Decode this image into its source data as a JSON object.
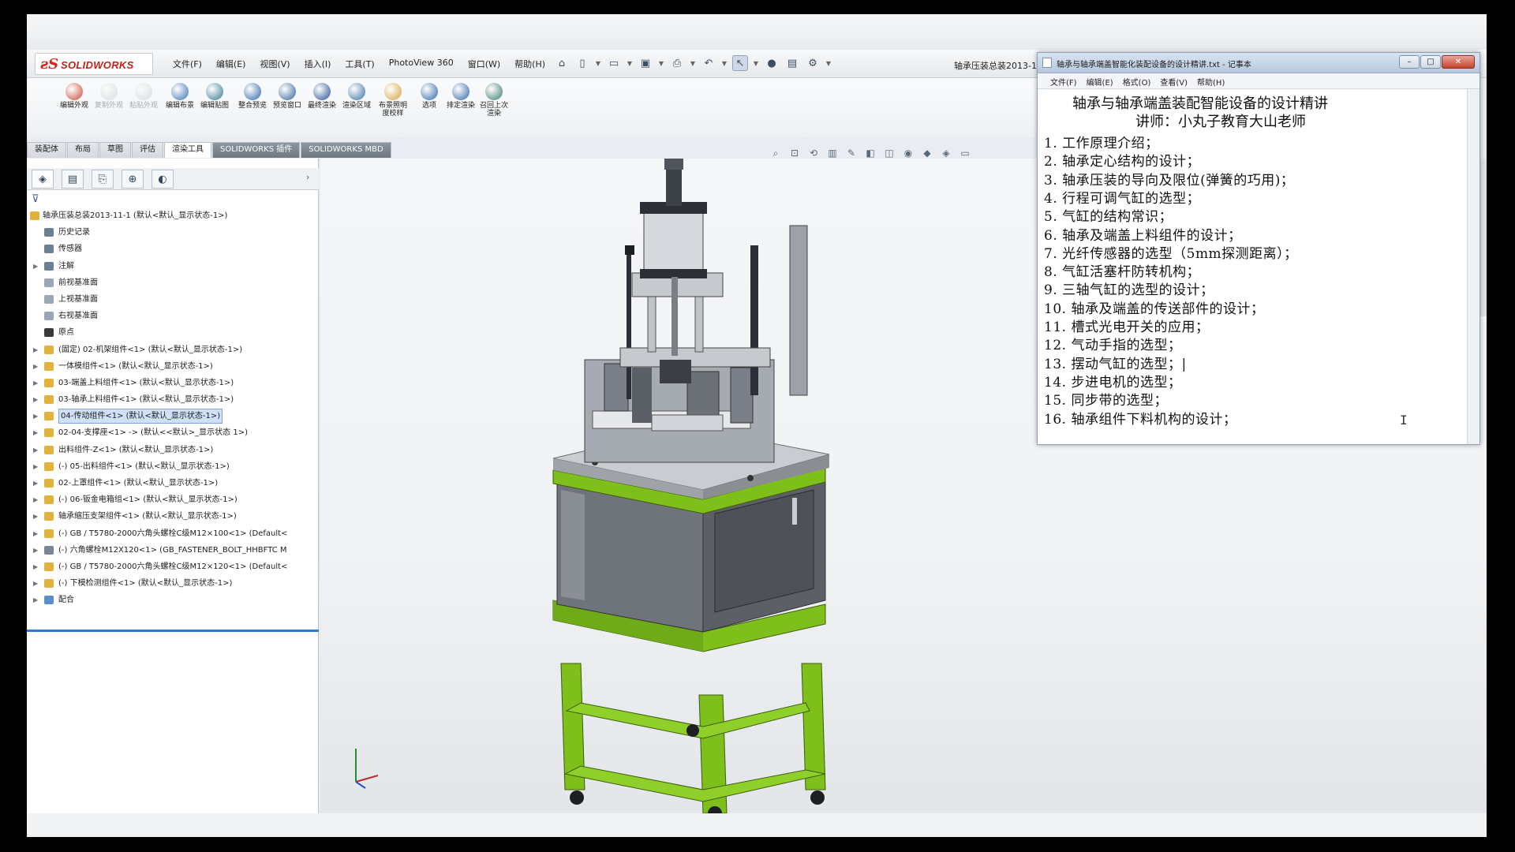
{
  "app": {
    "logo_ds": "ƨS",
    "logo_name": "SOLIDWORKS",
    "menus": [
      "文件(F)",
      "编辑(E)",
      "视图(V)",
      "插入(I)",
      "工具(T)",
      "PhotoView 360",
      "窗口(W)",
      "帮助(H)"
    ],
    "document_title": "轴承压装总装2013-1",
    "toolbar_icons": [
      "home-icon",
      "new-doc-icon",
      "open-icon",
      "save-icon",
      "print-icon",
      "undo-icon",
      "select-icon",
      "rebuild-icon",
      "file-props-icon",
      "options-icon"
    ]
  },
  "command_manager": {
    "commands": [
      {
        "label": "编辑外观",
        "disabled": false,
        "color": "#c84b3c"
      },
      {
        "label": "复制外观",
        "disabled": true,
        "color": "#9aa"
      },
      {
        "label": "粘贴外观",
        "disabled": true,
        "color": "#9aa"
      },
      {
        "label": "编辑布景",
        "disabled": false,
        "color": "#3b6fb6"
      },
      {
        "label": "编辑贴图",
        "disabled": false,
        "color": "#2f7a8c"
      },
      {
        "label": "整合预览",
        "disabled": false,
        "color": "#2d64a8"
      },
      {
        "label": "预览窗口",
        "disabled": false,
        "color": "#2f5f9a"
      },
      {
        "label": "最终渲染",
        "disabled": false,
        "color": "#1f4f8f"
      },
      {
        "label": "渲染区域",
        "disabled": false,
        "color": "#3a6ea8"
      },
      {
        "label": "布景照明度校样",
        "disabled": false,
        "color": "#d4a13a"
      },
      {
        "label": "选项",
        "disabled": false,
        "color": "#2d64a8"
      },
      {
        "label": "排定渲染",
        "disabled": false,
        "color": "#2d64a8"
      },
      {
        "label": "召回上次渲染",
        "disabled": false,
        "color": "#3a7a6a"
      }
    ]
  },
  "tabs": [
    "装配体",
    "布局",
    "草图",
    "评估",
    "渲染工具",
    "SOLIDWORKS 插件",
    "SOLIDWORKS MBD"
  ],
  "active_tab": "渲染工具",
  "feature_tree": {
    "root": "轴承压装总装2013-11-1 (默认<默认_显示状态-1>)",
    "items": [
      {
        "label": "历史记录",
        "indent": 1,
        "arrow": false,
        "icon": "history-icon"
      },
      {
        "label": "传感器",
        "indent": 1,
        "arrow": false,
        "icon": "sensor-icon"
      },
      {
        "label": "注解",
        "indent": 1,
        "arrow": true,
        "icon": "annotation-icon"
      },
      {
        "label": "前视基准面",
        "indent": 1,
        "arrow": false,
        "icon": "plane-icon"
      },
      {
        "label": "上视基准面",
        "indent": 1,
        "arrow": false,
        "icon": "plane-icon"
      },
      {
        "label": "右视基准面",
        "indent": 1,
        "arrow": false,
        "icon": "plane-icon"
      },
      {
        "label": "原点",
        "indent": 1,
        "arrow": false,
        "icon": "origin-icon"
      },
      {
        "label": "(固定) 02-机架组件<1> (默认<默认_显示状态-1>)",
        "indent": 1,
        "arrow": true,
        "icon": "assembly-icon"
      },
      {
        "label": "一体模组件<1> (默认<默认_显示状态-1>)",
        "indent": 1,
        "arrow": true,
        "icon": "assembly-icon"
      },
      {
        "label": "03-端盖上料组件<1> (默认<默认_显示状态-1>)",
        "indent": 1,
        "arrow": true,
        "icon": "assembly-icon"
      },
      {
        "label": "03-轴承上料组件<1> (默认<默认_显示状态-1>)",
        "indent": 1,
        "arrow": true,
        "icon": "assembly-icon"
      },
      {
        "label": "04-传动组件<1> (默认<默认_显示状态-1>)",
        "indent": 1,
        "arrow": true,
        "icon": "assembly-icon",
        "selected": true
      },
      {
        "label": "02-04-支撑座<1> -> (默认<<默认>_显示状态 1>)",
        "indent": 1,
        "arrow": true,
        "icon": "assembly-icon"
      },
      {
        "label": "出料组件-Z<1> (默认<默认_显示状态-1>)",
        "indent": 1,
        "arrow": true,
        "icon": "assembly-icon"
      },
      {
        "label": "(-) 05-出料组件<1> (默认<默认_显示状态-1>)",
        "indent": 1,
        "arrow": true,
        "icon": "assembly-icon"
      },
      {
        "label": "02-上罩组件<1> (默认<默认_显示状态-1>)",
        "indent": 1,
        "arrow": true,
        "icon": "assembly-icon"
      },
      {
        "label": "(-) 06-钣金电箱组<1> (默认<默认_显示状态-1>)",
        "indent": 1,
        "arrow": true,
        "icon": "assembly-icon"
      },
      {
        "label": "轴承缩压支架组件<1> (默认<默认_显示状态-1>)",
        "indent": 1,
        "arrow": true,
        "icon": "assembly-icon"
      },
      {
        "label": "(-) GB / T5780-2000六角头螺栓C级M12×100<1> (Default<",
        "indent": 1,
        "arrow": true,
        "icon": "part-icon"
      },
      {
        "label": "(-) 六角螺栓M12X120<1> (GB_FASTENER_BOLT_HHBFTC M",
        "indent": 1,
        "arrow": true,
        "icon": "bolt-icon"
      },
      {
        "label": "(-) GB / T5780-2000六角头螺栓C级M12×120<1> (Default<",
        "indent": 1,
        "arrow": true,
        "icon": "part-icon"
      },
      {
        "label": "(-) 下模检测组件<1> (默认<默认_显示状态-1>)",
        "indent": 1,
        "arrow": true,
        "icon": "assembly-icon"
      },
      {
        "label": "配合",
        "indent": 1,
        "arrow": true,
        "icon": "mates-icon"
      }
    ]
  },
  "notepad": {
    "title": "轴承与轴承端盖智能化装配设备的设计精讲.txt - 记事本",
    "menus": [
      "文件(F)",
      "编辑(E)",
      "格式(O)",
      "查看(V)",
      "帮助(H)"
    ],
    "heading": "轴承与轴承端盖装配智能设备的设计精讲",
    "subheading": "讲师：小丸子教育大山老师",
    "lines": [
      "1. 工作原理介绍；",
      "2. 轴承定心结构的设计；",
      "3. 轴承压装的导向及限位(弹簧的巧用)；",
      "4. 行程可调气缸的选型；",
      "5. 气缸的结构常识；",
      "6. 轴承及端盖上料组件的设计；",
      "7. 光纤传感器的选型（5mm探测距离）；",
      "8. 气缸活塞杆防转机构；",
      "9. 三轴气缸的选型的设计；",
      "10. 轴承及端盖的传送部件的设计；",
      "11. 槽式光电开关的应用；",
      "12. 气动手指的选型；",
      "13. 摆动气缸的选型；|",
      "14. 步进电机的选型；",
      "15. 同步带的选型；",
      "16. 轴承组件下料机构的设计；"
    ]
  },
  "colors": {
    "frame_green": "#7fbf1c",
    "cabinet_gray": "#6f737a",
    "selection_blue": "#cfe0f7"
  }
}
